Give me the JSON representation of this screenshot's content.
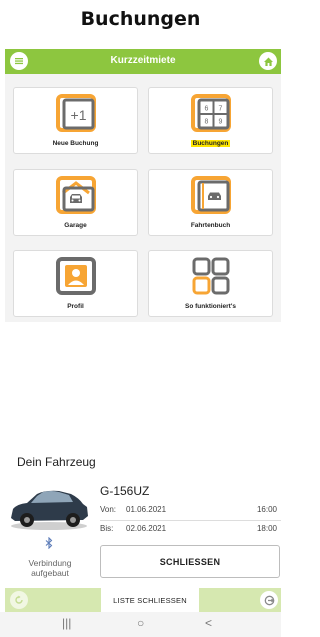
{
  "caption": "Buchungen",
  "appbar": {
    "title": "Kurzzeitmiete",
    "left_icon": "menu-icon",
    "right_icon": "home-icon"
  },
  "tiles": [
    {
      "id": "neue-buchung",
      "label": "Neue Buchung",
      "icon": "plus-one-icon",
      "highlighted": false
    },
    {
      "id": "buchungen",
      "label": "Buchungen",
      "icon": "calendar-grid-icon",
      "highlighted": true,
      "icon_text": [
        "6",
        "7",
        "8",
        "9"
      ]
    },
    {
      "id": "garage",
      "label": "Garage",
      "icon": "garage-icon",
      "highlighted": false
    },
    {
      "id": "fahrtenbuch",
      "label": "Fahrtenbuch",
      "icon": "car-book-icon",
      "highlighted": false
    },
    {
      "id": "profil",
      "label": "Profil",
      "icon": "profile-icon",
      "highlighted": false
    },
    {
      "id": "so-funktionierts",
      "label": "So funktioniert's",
      "icon": "four-squares-icon",
      "highlighted": false
    },
    {
      "id": "plus-one",
      "label": "+1"
    }
  ],
  "vehicle": {
    "heading": "Dein Fahrzeug",
    "plate": "G-156UZ",
    "from_label": "Von:",
    "from_date": "01.06.2021",
    "from_time": "16:00",
    "to_label": "Bis:",
    "to_date": "02.06.2021",
    "to_time": "18:00",
    "connection_status": "Verbindung aufgebaut",
    "close_button": "SCHLIESSEN"
  },
  "bottombar": {
    "list_close": "LISTE SCHLIESSEN"
  },
  "navbar": {
    "recent": "|||",
    "home": "○",
    "back": "<"
  },
  "colors": {
    "brand": "#8dc63f",
    "accent": "#f7a534",
    "icon_gray": "#6b6b6b",
    "highlight": "#ffe600"
  }
}
